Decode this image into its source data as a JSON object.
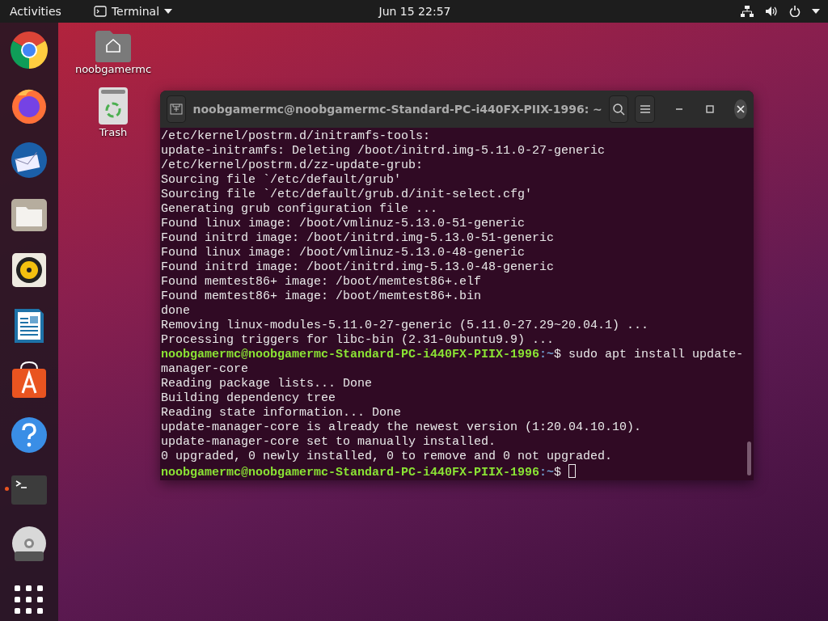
{
  "top_bar": {
    "activities": "Activities",
    "app_menu": "Terminal",
    "clock": "Jun 15  22:57"
  },
  "dock": {
    "items": [
      {
        "kind": "chrome",
        "running": false
      },
      {
        "kind": "firefox",
        "running": false
      },
      {
        "kind": "thunderbird",
        "running": false
      },
      {
        "kind": "files",
        "running": false
      },
      {
        "kind": "rhythmbox",
        "running": false
      },
      {
        "kind": "writer",
        "running": false
      },
      {
        "kind": "software",
        "running": false
      },
      {
        "kind": "help",
        "running": false
      },
      {
        "kind": "terminal",
        "running": true
      },
      {
        "kind": "dvd",
        "running": false
      },
      {
        "kind": "apps",
        "running": false
      }
    ]
  },
  "desktop_icons": [
    {
      "kind": "home",
      "label": "noobgamermc"
    },
    {
      "kind": "trash",
      "label": "Trash"
    }
  ],
  "terminal": {
    "title": "noobgamermc@noobgamermc-Standard-PC-i440FX-PIIX-1996: ~",
    "lines": [
      {
        "kind": "output",
        "text": "/etc/kernel/postrm.d/initramfs-tools:"
      },
      {
        "kind": "output",
        "text": "update-initramfs: Deleting /boot/initrd.img-5.11.0-27-generic"
      },
      {
        "kind": "output",
        "text": "/etc/kernel/postrm.d/zz-update-grub:"
      },
      {
        "kind": "output",
        "text": "Sourcing file `/etc/default/grub'"
      },
      {
        "kind": "output",
        "text": "Sourcing file `/etc/default/grub.d/init-select.cfg'"
      },
      {
        "kind": "output",
        "text": "Generating grub configuration file ..."
      },
      {
        "kind": "output",
        "text": "Found linux image: /boot/vmlinuz-5.13.0-51-generic"
      },
      {
        "kind": "output",
        "text": "Found initrd image: /boot/initrd.img-5.13.0-51-generic"
      },
      {
        "kind": "output",
        "text": "Found linux image: /boot/vmlinuz-5.13.0-48-generic"
      },
      {
        "kind": "output",
        "text": "Found initrd image: /boot/initrd.img-5.13.0-48-generic"
      },
      {
        "kind": "output",
        "text": "Found memtest86+ image: /boot/memtest86+.elf"
      },
      {
        "kind": "output",
        "text": "Found memtest86+ image: /boot/memtest86+.bin"
      },
      {
        "kind": "output",
        "text": "done"
      },
      {
        "kind": "output",
        "text": "Removing linux-modules-5.11.0-27-generic (5.11.0-27.29~20.04.1) ..."
      },
      {
        "kind": "output",
        "text": "Processing triggers for libc-bin (2.31-0ubuntu9.9) ..."
      },
      {
        "kind": "prompt",
        "user_host": "noobgamermc@noobgamermc-Standard-PC-i440FX-PIIX-1996",
        "path": ":~",
        "symbol": "$",
        "command": "sudo apt install update-",
        "cursor": false
      },
      {
        "kind": "output",
        "text": "manager-core"
      },
      {
        "kind": "output",
        "text": "Reading package lists... Done"
      },
      {
        "kind": "output",
        "text": "Building dependency tree"
      },
      {
        "kind": "output",
        "text": "Reading state information... Done"
      },
      {
        "kind": "output",
        "text": "update-manager-core is already the newest version (1:20.04.10.10)."
      },
      {
        "kind": "output",
        "text": "update-manager-core set to manually installed."
      },
      {
        "kind": "output",
        "text": "0 upgraded, 0 newly installed, 0 to remove and 0 not upgraded."
      },
      {
        "kind": "prompt",
        "user_host": "noobgamermc@noobgamermc-Standard-PC-i440FX-PIIX-1996",
        "path": ":~",
        "symbol": "$",
        "cursor": true
      }
    ]
  }
}
